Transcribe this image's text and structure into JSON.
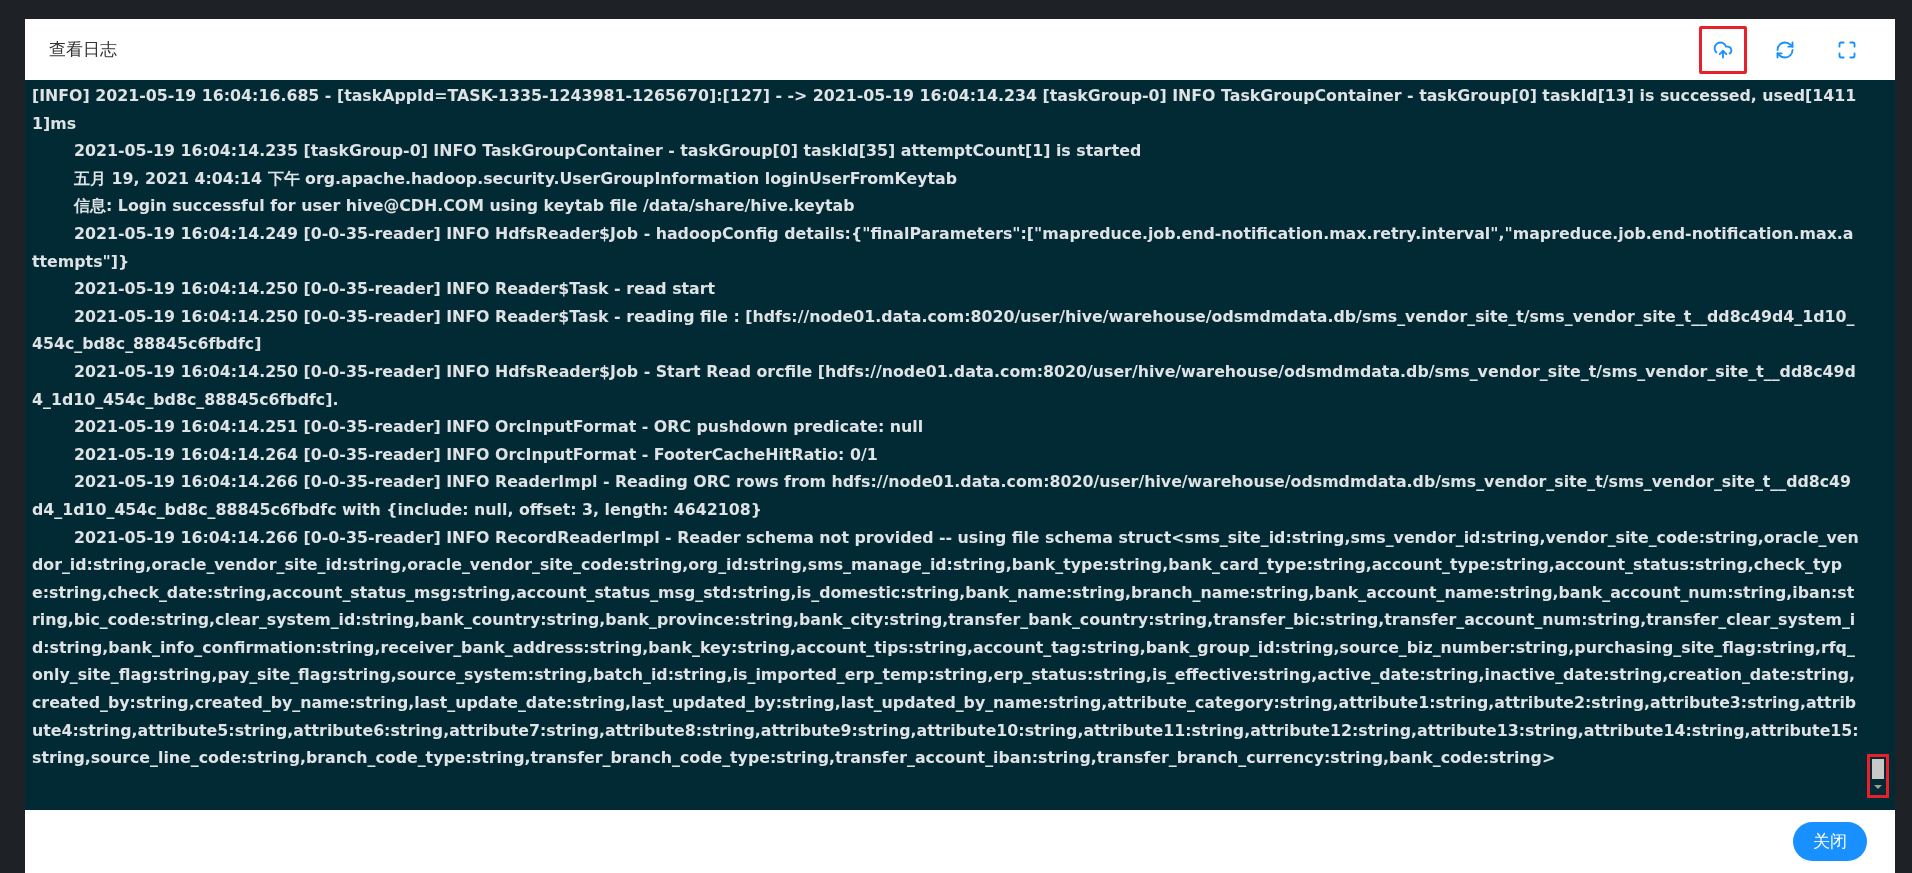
{
  "dialog": {
    "title": "查看日志",
    "toolbar": [
      {
        "kind": "cloud",
        "highlighted": true
      },
      {
        "kind": "refresh",
        "highlighted": false
      },
      {
        "kind": "fullscreen",
        "highlighted": false
      }
    ],
    "log": [
      {
        "text": "[INFO] 2021-05-19 16:04:16.685  - [taskAppId=TASK-1335-1243981-1265670]:[127] -  -> 2021-05-19 16:04:14.234 [taskGroup-0] INFO  TaskGroupContainer - taskGroup[0] taskId[13] is successed, used[14111]ms",
        "indented": false
      },
      {
        "text": "2021-05-19 16:04:14.235 [taskGroup-0] INFO  TaskGroupContainer - taskGroup[0] taskId[35] attemptCount[1] is started",
        "indented": true
      },
      {
        "text": "五月 19, 2021 4:04:14 下午 org.apache.hadoop.security.UserGroupInformation loginUserFromKeytab",
        "indented": true
      },
      {
        "text": "信息: Login successful for user hive@CDH.COM using keytab file /data/share/hive.keytab",
        "indented": true
      },
      {
        "text": "2021-05-19 16:04:14.249 [0-0-35-reader] INFO  HdfsReader$Job - hadoopConfig details:{\"finalParameters\":[\"mapreduce.job.end-notification.max.retry.interval\",\"mapreduce.job.end-notification.max.attempts\"]}",
        "indented": true
      },
      {
        "text": "2021-05-19 16:04:14.250 [0-0-35-reader] INFO  Reader$Task - read start",
        "indented": true
      },
      {
        "text": "2021-05-19 16:04:14.250 [0-0-35-reader] INFO  Reader$Task - reading file : [hdfs://node01.data.com:8020/user/hive/warehouse/odsmdmdata.db/sms_vendor_site_t/sms_vendor_site_t__dd8c49d4_1d10_454c_bd8c_88845c6fbdfc]",
        "indented": true
      },
      {
        "text": "2021-05-19 16:04:14.250 [0-0-35-reader] INFO  HdfsReader$Job - Start Read orcfile [hdfs://node01.data.com:8020/user/hive/warehouse/odsmdmdata.db/sms_vendor_site_t/sms_vendor_site_t__dd8c49d4_1d10_454c_bd8c_88845c6fbdfc].",
        "indented": true
      },
      {
        "text": "2021-05-19 16:04:14.251 [0-0-35-reader] INFO  OrcInputFormat - ORC pushdown predicate: null",
        "indented": true
      },
      {
        "text": "2021-05-19 16:04:14.264 [0-0-35-reader] INFO  OrcInputFormat - FooterCacheHitRatio: 0/1",
        "indented": true
      },
      {
        "text": "2021-05-19 16:04:14.266 [0-0-35-reader] INFO  ReaderImpl - Reading ORC rows from hdfs://node01.data.com:8020/user/hive/warehouse/odsmdmdata.db/sms_vendor_site_t/sms_vendor_site_t__dd8c49d4_1d10_454c_bd8c_88845c6fbdfc with {include: null, offset: 3, length: 4642108}",
        "indented": true
      },
      {
        "text": "2021-05-19 16:04:14.266 [0-0-35-reader] INFO  RecordReaderImpl - Reader schema not provided -- using file schema struct<sms_site_id:string,sms_vendor_id:string,vendor_site_code:string,oracle_vendor_id:string,oracle_vendor_site_id:string,oracle_vendor_site_code:string,org_id:string,sms_manage_id:string,bank_type:string,bank_card_type:string,account_type:string,account_status:string,check_type:string,check_date:string,account_status_msg:string,account_status_msg_std:string,is_domestic:string,bank_name:string,branch_name:string,bank_account_name:string,bank_account_num:string,iban:string,bic_code:string,clear_system_id:string,bank_country:string,bank_province:string,bank_city:string,transfer_bank_country:string,transfer_bic:string,transfer_account_num:string,transfer_clear_system_id:string,bank_info_confirmation:string,receiver_bank_address:string,bank_key:string,account_tips:string,account_tag:string,bank_group_id:string,source_biz_number:string,purchasing_site_flag:string,rfq_only_site_flag:string,pay_site_flag:string,source_system:string,batch_id:string,is_imported_erp_temp:string,erp_status:string,is_effective:string,active_date:string,inactive_date:string,creation_date:string,created_by:string,created_by_name:string,last_update_date:string,last_updated_by:string,last_updated_by_name:string,attribute_category:string,attribute1:string,attribute2:string,attribute3:string,attribute4:string,attribute5:string,attribute6:string,attribute7:string,attribute8:string,attribute9:string,attribute10:string,attribute11:string,attribute12:string,attribute13:string,attribute14:string,attribute15:string,source_line_code:string,branch_code_type:string,transfer_branch_code_type:string,transfer_account_iban:string,transfer_branch_currency:string,bank_code:string>",
        "indented": true
      }
    ],
    "scrollbar": {
      "highlighted": true
    },
    "close_button": "关闭"
  }
}
